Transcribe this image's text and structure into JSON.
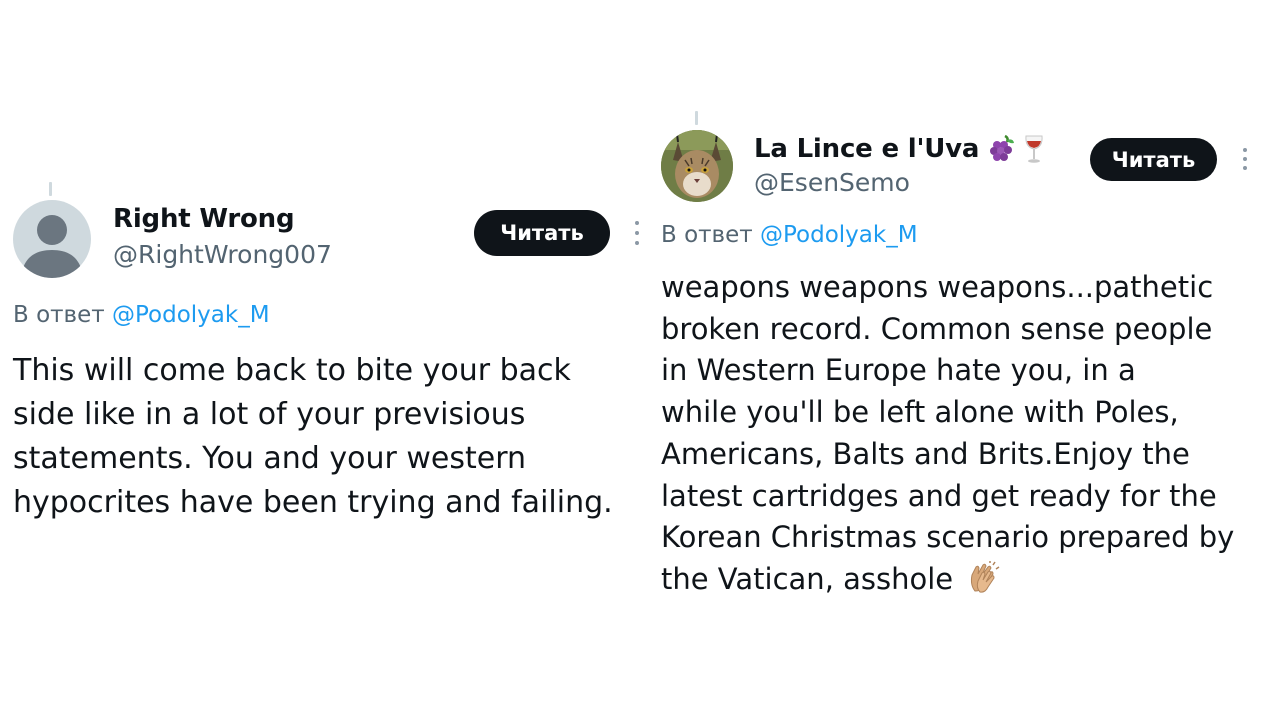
{
  "tweets": [
    {
      "display_name": "Right Wrong",
      "handle": "@RightWrong007",
      "follow_label": "Читать",
      "reply_prefix": "В ответ",
      "reply_to": "@Podolyak_M",
      "text_lines": [
        "This will come back to bite your back",
        "side like in a lot of your previsious",
        "statements. You and your western",
        "hypocrites have been trying and failing."
      ]
    },
    {
      "display_name": "La Lince e l'Uva",
      "name_emojis": [
        "grapes-emoji",
        "wine-glass-emoji"
      ],
      "handle": "@EsenSemo",
      "follow_label": "Читать",
      "reply_prefix": "В ответ",
      "reply_to": "@Podolyak_M",
      "text_lines": [
        "weapons weapons weapons...pathetic",
        "broken record. Common sense people",
        "in Western Europe hate you, in a",
        "while you'll be left alone with Poles,",
        "Americans, Balts and Brits.Enjoy the",
        "latest cartridges and get ready for the",
        "Korean Christmas scenario prepared by",
        "the Vatican, asshole"
      ],
      "trailing_emoji": "clapping-hands-emoji"
    }
  ],
  "colors": {
    "text": "#0f1419",
    "secondary": "#536471",
    "link": "#1d9bf0",
    "button_bg": "#0f1419",
    "button_text": "#ffffff"
  }
}
